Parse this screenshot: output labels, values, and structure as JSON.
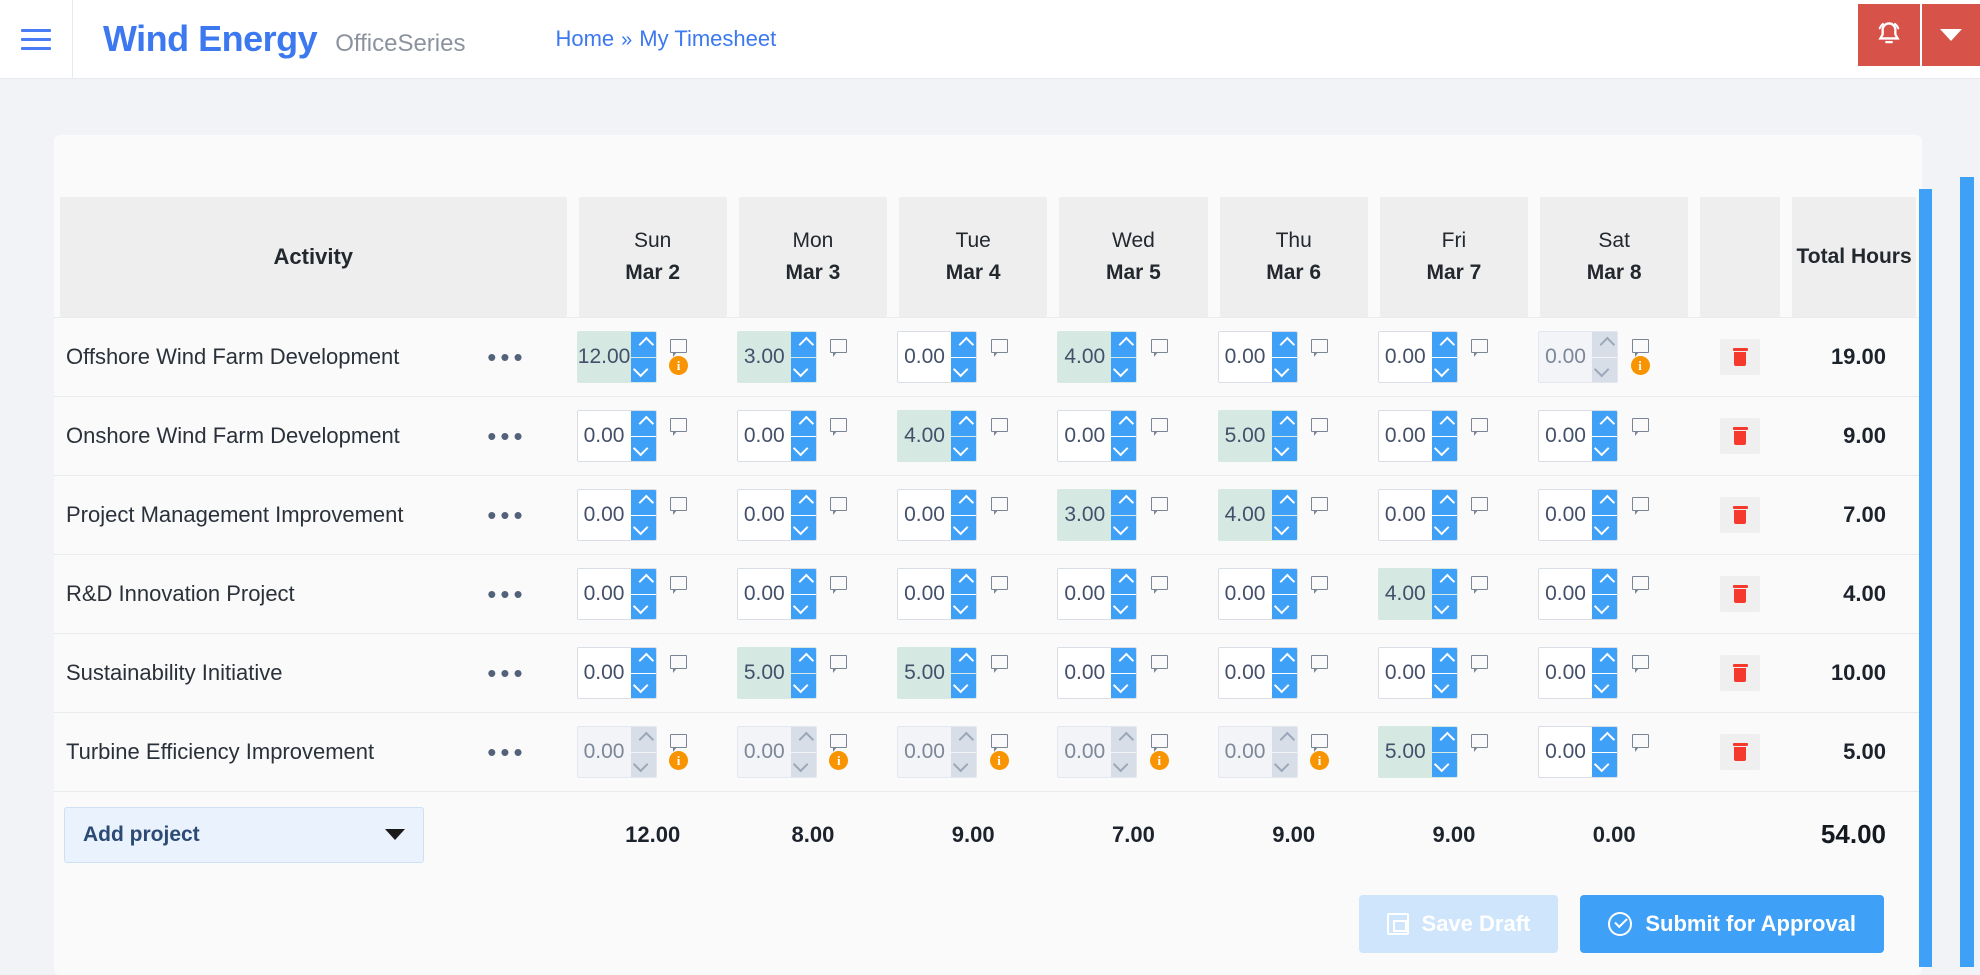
{
  "topbar": {
    "menu_icon": "hamburger-icon",
    "brand": "Wind Energy",
    "brand_sub": "OfficeSeries",
    "breadcrumb": {
      "home": "Home",
      "separator": "»",
      "current": "My Timesheet"
    },
    "alert_icon": "bell-icon",
    "alert_caret_icon": "chevron-down-icon",
    "accent_red": "#d7534a",
    "accent_blue": "#3c78f0"
  },
  "table": {
    "activity_header": "Activity",
    "total_header": "Total Hours",
    "days": [
      {
        "name": "Sun",
        "date": "Mar 2"
      },
      {
        "name": "Mon",
        "date": "Mar 3"
      },
      {
        "name": "Tue",
        "date": "Mar 4"
      },
      {
        "name": "Wed",
        "date": "Mar 5"
      },
      {
        "name": "Thu",
        "date": "Mar 6"
      },
      {
        "name": "Fri",
        "date": "Mar 7"
      },
      {
        "name": "Sat",
        "date": "Mar 8"
      }
    ],
    "rows": [
      {
        "activity": "Offshore Wind Farm Development",
        "total": "19.00",
        "cells": [
          {
            "value": "12.00",
            "state": "filled",
            "info": true
          },
          {
            "value": "3.00",
            "state": "filled",
            "info": false
          },
          {
            "value": "0.00",
            "state": "empty",
            "info": false
          },
          {
            "value": "4.00",
            "state": "filled",
            "info": false
          },
          {
            "value": "0.00",
            "state": "empty",
            "info": false
          },
          {
            "value": "0.00",
            "state": "empty",
            "info": false
          },
          {
            "value": "0.00",
            "state": "disabled",
            "info": true
          }
        ]
      },
      {
        "activity": "Onshore Wind Farm Development",
        "total": "9.00",
        "cells": [
          {
            "value": "0.00",
            "state": "empty",
            "info": false
          },
          {
            "value": "0.00",
            "state": "empty",
            "info": false
          },
          {
            "value": "4.00",
            "state": "filled",
            "info": false
          },
          {
            "value": "0.00",
            "state": "empty",
            "info": false
          },
          {
            "value": "5.00",
            "state": "filled",
            "info": false
          },
          {
            "value": "0.00",
            "state": "empty",
            "info": false
          },
          {
            "value": "0.00",
            "state": "empty",
            "info": false
          }
        ]
      },
      {
        "activity": "Project Management Improvement",
        "total": "7.00",
        "cells": [
          {
            "value": "0.00",
            "state": "empty",
            "info": false
          },
          {
            "value": "0.00",
            "state": "empty",
            "info": false
          },
          {
            "value": "0.00",
            "state": "empty",
            "info": false
          },
          {
            "value": "3.00",
            "state": "filled",
            "info": false
          },
          {
            "value": "4.00",
            "state": "filled",
            "info": false
          },
          {
            "value": "0.00",
            "state": "empty",
            "info": false
          },
          {
            "value": "0.00",
            "state": "empty",
            "info": false
          }
        ]
      },
      {
        "activity": "R&D Innovation Project",
        "total": "4.00",
        "cells": [
          {
            "value": "0.00",
            "state": "empty",
            "info": false
          },
          {
            "value": "0.00",
            "state": "empty",
            "info": false
          },
          {
            "value": "0.00",
            "state": "empty",
            "info": false
          },
          {
            "value": "0.00",
            "state": "empty",
            "info": false
          },
          {
            "value": "0.00",
            "state": "empty",
            "info": false
          },
          {
            "value": "4.00",
            "state": "filled",
            "info": false
          },
          {
            "value": "0.00",
            "state": "empty",
            "info": false
          }
        ]
      },
      {
        "activity": "Sustainability Initiative",
        "total": "10.00",
        "cells": [
          {
            "value": "0.00",
            "state": "empty",
            "info": false
          },
          {
            "value": "5.00",
            "state": "filled",
            "info": false
          },
          {
            "value": "5.00",
            "state": "filled",
            "info": false
          },
          {
            "value": "0.00",
            "state": "empty",
            "info": false
          },
          {
            "value": "0.00",
            "state": "empty",
            "info": false
          },
          {
            "value": "0.00",
            "state": "empty",
            "info": false
          },
          {
            "value": "0.00",
            "state": "empty",
            "info": false
          }
        ]
      },
      {
        "activity": "Turbine Efficiency Improvement",
        "total": "5.00",
        "cells": [
          {
            "value": "0.00",
            "state": "disabled",
            "info": true
          },
          {
            "value": "0.00",
            "state": "disabled",
            "info": true
          },
          {
            "value": "0.00",
            "state": "disabled",
            "info": true
          },
          {
            "value": "0.00",
            "state": "disabled",
            "info": true
          },
          {
            "value": "0.00",
            "state": "disabled",
            "info": true
          },
          {
            "value": "5.00",
            "state": "filled",
            "info": false
          },
          {
            "value": "0.00",
            "state": "empty",
            "info": false
          }
        ]
      }
    ],
    "row_menu_icon": "ellipsis-icon",
    "delete_icon": "trash-icon",
    "comment_icon": "comment-icon",
    "info_icon": "info-icon",
    "column_totals": [
      "12.00",
      "8.00",
      "9.00",
      "7.00",
      "9.00",
      "9.00",
      "0.00"
    ],
    "grand_total": "54.00"
  },
  "footer": {
    "add_project_label": "Add project",
    "add_project_caret": "chevron-down-icon",
    "save_draft_label": "Save Draft",
    "save_draft_icon": "save-icon",
    "submit_label": "Submit for Approval",
    "submit_icon": "check-circle-icon"
  },
  "colors": {
    "filled_cell": "#d5e8e2",
    "spinner_blue": "#3fa0f7",
    "info_orange": "#f79400",
    "delete_red": "#f5392c"
  }
}
